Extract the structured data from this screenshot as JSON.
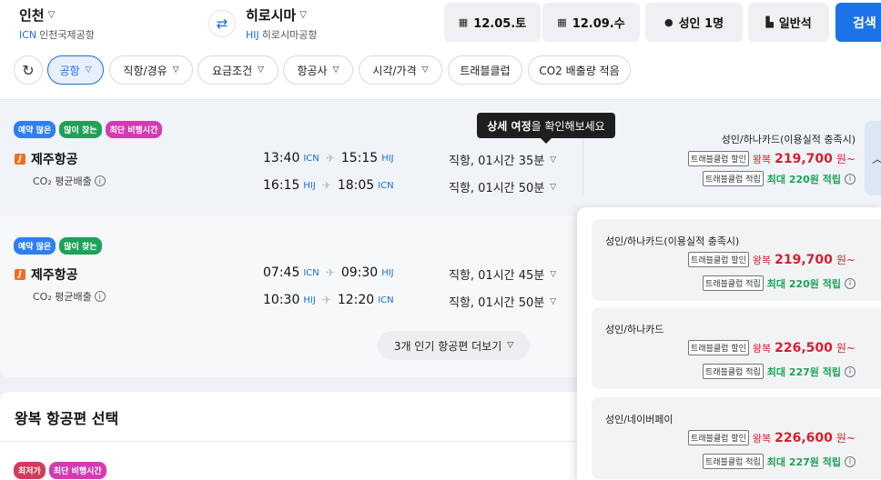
{
  "search": {
    "origin": {
      "name": "인천",
      "code": "ICN",
      "airport": "인천국제공항"
    },
    "destination": {
      "name": "히로시마",
      "code": "HIJ",
      "airport": "히로시마공항"
    },
    "depart_date": "12.05.토",
    "return_date": "12.09.수",
    "passengers": "성인 1명",
    "cabin": "일반석",
    "search_label": "검색"
  },
  "filters": [
    "공항",
    "직항/경유",
    "요금조건",
    "항공사",
    "시각/가격",
    "트래블클럽",
    "CO2 배출량 적음"
  ],
  "tooltip": {
    "bold": "상세 여정",
    "rest": "을 확인해보세요"
  },
  "results": [
    {
      "badges": [
        "예약 많은",
        "많이 찾는",
        "최단 비행시간"
      ],
      "airline": "제주항공",
      "co2": "CO₂ 평균배출",
      "legs": [
        {
          "dep": "13:40",
          "dep_ap": "ICN",
          "arr": "15:15",
          "arr_ap": "HIJ",
          "duration": "직항, 01시간 35분"
        },
        {
          "dep": "16:15",
          "dep_ap": "HIJ",
          "arr": "18:05",
          "arr_ap": "ICN",
          "duration": "직항, 01시간 50분"
        }
      ],
      "price": {
        "title": "성인/하나카드(이용실적 충족시)",
        "tag_discount": "트래블클럽 할인",
        "round": "왕복",
        "amount": "219,700",
        "won": "원~",
        "tag_earn": "트래블클럽 적립",
        "earn": "최대 220원 적립"
      }
    },
    {
      "badges": [
        "예약 많은",
        "많이 찾는"
      ],
      "airline": "제주항공",
      "co2": "CO₂ 평균배출",
      "legs": [
        {
          "dep": "07:45",
          "dep_ap": "ICN",
          "arr": "09:30",
          "arr_ap": "HIJ",
          "duration": "직항, 01시간 45분"
        },
        {
          "dep": "10:30",
          "dep_ap": "HIJ",
          "arr": "12:20",
          "arr_ap": "ICN",
          "duration": "직항, 01시간 50분"
        }
      ]
    }
  ],
  "more_label": "3개 인기 항공편 더보기",
  "section_title": "왕복 항공편 선택",
  "bottom_badges": [
    "최저가",
    "최단 비행시간"
  ],
  "price_options": [
    {
      "title": "성인/하나카드(이용실적 충족시)",
      "tag_discount": "트래블클럽 할인",
      "round": "왕복",
      "amount": "219,700",
      "won": "원~",
      "tag_earn": "트래블클럽 적립",
      "earn": "최대 220원 적립"
    },
    {
      "title": "성인/하나카드",
      "tag_discount": "트래블클럽 할인",
      "round": "왕복",
      "amount": "226,500",
      "won": "원~",
      "tag_earn": "트래블클럽 적립",
      "earn": "최대 227원 적립"
    },
    {
      "title": "성인/네이버페이",
      "tag_discount": "트래블클럽 할인",
      "round": "왕복",
      "amount": "226,600",
      "won": "원~",
      "tag_earn": "트래블클럽 적립",
      "earn": "최대 227원 적립"
    }
  ],
  "colors": {
    "accent": "#1a73e8",
    "price": "#d3212d",
    "earn": "#1fa15a",
    "badge_blue": "#2f7ff0",
    "badge_green": "#1fa15a",
    "badge_pink": "#d63ab3"
  }
}
